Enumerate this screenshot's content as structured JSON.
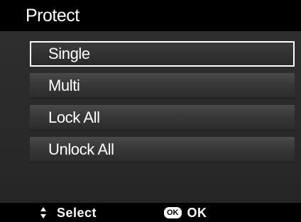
{
  "header": {
    "title": "Protect"
  },
  "menu": {
    "items": [
      {
        "label": "Single",
        "selected": true
      },
      {
        "label": "Multi",
        "selected": false
      },
      {
        "label": "Lock All",
        "selected": false
      },
      {
        "label": "Unlock All",
        "selected": false
      }
    ]
  },
  "footer": {
    "select_icon": "up-down-arrows-icon",
    "select_label": "Select",
    "ok_icon_text": "OK",
    "ok_label": "OK"
  },
  "colors": {
    "background": "#000000",
    "panel": "#2a2a2a",
    "item": "#3a3a3a",
    "selected_border": "#ffffff",
    "text": "#ffffff"
  }
}
